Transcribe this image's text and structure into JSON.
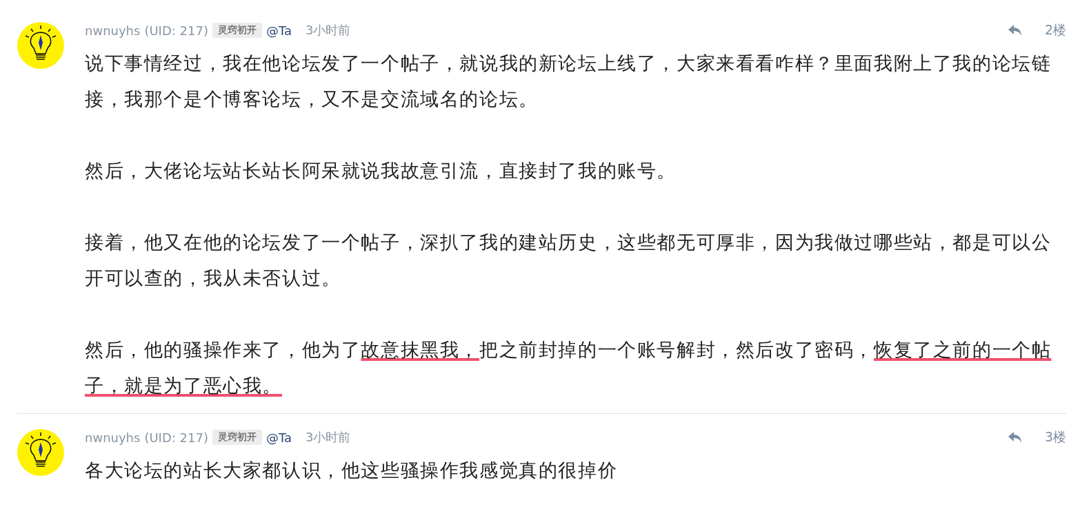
{
  "posts": [
    {
      "author": "nwnuyhs",
      "uid": "(UID: 217)",
      "badge": "灵窍初开",
      "mention": "@Ta",
      "time": "3小时前",
      "floor": "2楼",
      "paragraphs": [
        [
          {
            "text": "说下事情经过，我在他论坛发了一个帖子，就说我的新论坛上线了，大家来看看咋样？里面我附上了我的论坛链接，我那个是个博客论坛，又不是交流域名的论坛。",
            "marked": false
          }
        ],
        [
          {
            "text": "然后，大佬论坛站长站长阿呆就说我故意引流，直接封了我的账号。",
            "marked": false
          }
        ],
        [
          {
            "text": "接着，他又在他的论坛发了一个帖子，深扒了我的建站历史，这些都无可厚非，因为我做过哪些站，都是可以公开可以查的，我从未否认过。",
            "marked": false
          }
        ],
        [
          {
            "text": "然后，他的骚操作来了，他为了",
            "marked": false
          },
          {
            "text": "故意抹黑我，",
            "marked": true
          },
          {
            "text": "把之前封掉的一个账号解封，然后改了密码，",
            "marked": false
          },
          {
            "text": "恢复了之前的一个帖子，就是为了恶心我。",
            "marked": true
          }
        ]
      ]
    },
    {
      "author": "nwnuyhs",
      "uid": "(UID: 217)",
      "badge": "灵窍初开",
      "mention": "@Ta",
      "time": "3小时前",
      "floor": "3楼",
      "paragraphs": [
        [
          {
            "text": "各大论坛的站长大家都认识，他这些骚操作我感觉真的很掉价",
            "marked": false
          }
        ]
      ]
    }
  ]
}
